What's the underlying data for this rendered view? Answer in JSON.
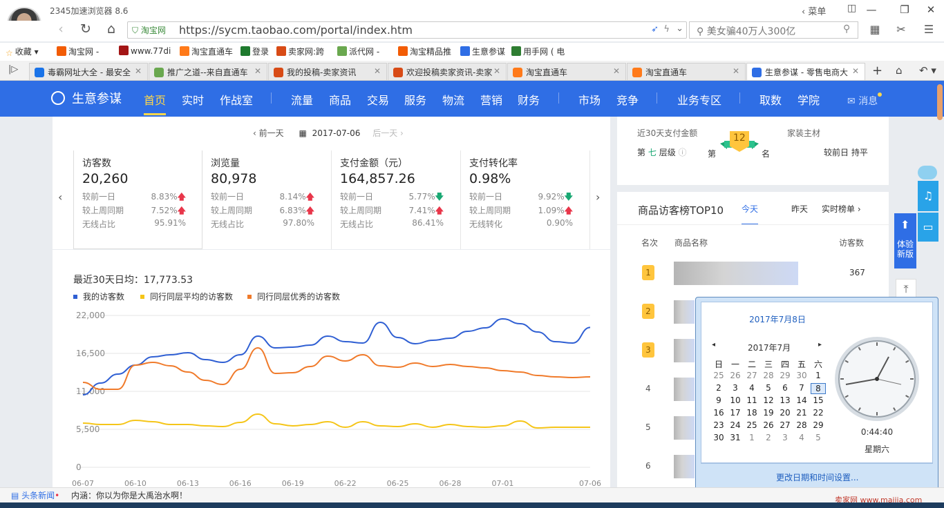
{
  "browser": {
    "title": "2345加速浏览器 8.6",
    "menu_label": "菜单",
    "url": "https://sycm.taobao.com/portal/index.htm",
    "safe_label": "淘宝网",
    "search_placeholder": "美女骗40万人300亿"
  },
  "bookmarks": [
    "收藏",
    "淘宝网 -",
    "www.77di",
    "淘宝直通车",
    "登录",
    "卖家网:跨",
    "派代网 -",
    "淘宝精品推",
    "生意参谋",
    "用手网 ( 电"
  ],
  "tabs": [
    "毒霸网址大全 - 最安全",
    "推广之道--来自直通车",
    "我的投稿-卖家资讯",
    "欢迎投稿卖家资讯-卖家",
    "淘宝直通车",
    "淘宝直通车",
    "生意参谋 - 零售电商大"
  ],
  "app": {
    "brand": "生意参谋",
    "menu": [
      "首页",
      "实时",
      "作战室",
      "流量",
      "商品",
      "交易",
      "服务",
      "物流",
      "营销",
      "财务",
      "市场",
      "竞争",
      "业务专区",
      "取数",
      "学院"
    ],
    "msg": "消息"
  },
  "datebar": {
    "prev": "前一天",
    "date": "2017-07-06",
    "next": "后一天"
  },
  "metrics": [
    {
      "title": "访客数",
      "value": "20,260",
      "r1l": "较前一日",
      "r1v": "8.83%",
      "r1d": "up",
      "r2l": "较上周同期",
      "r2v": "7.52%",
      "r2d": "up",
      "r3l": "无线占比",
      "r3v": "95.91%"
    },
    {
      "title": "浏览量",
      "value": "80,978",
      "r1l": "较前一日",
      "r1v": "8.14%",
      "r1d": "up",
      "r2l": "较上周同期",
      "r2v": "6.83%",
      "r2d": "up",
      "r3l": "无线占比",
      "r3v": "97.80%"
    },
    {
      "title": "支付金额（元）",
      "value": "164,857.26",
      "r1l": "较前一日",
      "r1v": "5.77%",
      "r1d": "dn",
      "r2l": "较上周同期",
      "r2v": "7.41%",
      "r2d": "up",
      "r3l": "无线占比",
      "r3v": "86.41%"
    },
    {
      "title": "支付转化率",
      "value": "0.98%",
      "r1l": "较前一日",
      "r1v": "9.92%",
      "r1d": "dn",
      "r2l": "较上周同期",
      "r2v": "1.09%",
      "r2d": "up",
      "r3l": "无线转化",
      "r3v": "0.90%"
    }
  ],
  "avg_text": "最近30天日均：17,773.53",
  "chart_data": {
    "type": "line",
    "x": [
      "06-07",
      "06-08",
      "06-09",
      "06-10",
      "06-11",
      "06-12",
      "06-13",
      "06-14",
      "06-15",
      "06-16",
      "06-17",
      "06-18",
      "06-19",
      "06-20",
      "06-21",
      "06-22",
      "06-23",
      "06-24",
      "06-25",
      "06-26",
      "06-27",
      "06-28",
      "06-29",
      "06-30",
      "07-01",
      "07-02",
      "07-03",
      "07-04",
      "07-05",
      "07-06"
    ],
    "x_ticks": [
      "06-07",
      "06-10",
      "06-13",
      "06-16",
      "06-19",
      "06-22",
      "06-25",
      "06-28",
      "07-01",
      "07-06"
    ],
    "y_ticks": [
      "22,000",
      "16,500",
      "11,000",
      "5,500",
      "0"
    ],
    "ylim": [
      0,
      22000
    ],
    "series": [
      {
        "name": "我的访客数",
        "color": "#2f5fd3",
        "values": [
          10500,
          12200,
          13500,
          14800,
          16000,
          16300,
          16600,
          15600,
          15200,
          16300,
          19000,
          17300,
          17400,
          17700,
          19000,
          18200,
          18000,
          21000,
          18800,
          17900,
          18400,
          18700,
          19700,
          20200,
          21500,
          20800,
          19600,
          18200,
          18000,
          20260
        ]
      },
      {
        "name": "同行同层平均的访客数",
        "color": "#f5c518",
        "values": [
          6400,
          6200,
          6200,
          6800,
          6600,
          6200,
          6200,
          6000,
          5900,
          6500,
          7700,
          6300,
          6000,
          6200,
          6600,
          5800,
          6600,
          6000,
          5900,
          6300,
          5800,
          6200,
          5900,
          5800,
          6000,
          6700,
          5700,
          5800,
          5800,
          5800
        ]
      },
      {
        "name": "同行同层优秀的访客数",
        "color": "#f07a2a",
        "values": [
          12300,
          11300,
          11300,
          14800,
          15200,
          14700,
          13800,
          12600,
          12000,
          14200,
          17300,
          13600,
          13700,
          14600,
          16100,
          15400,
          16300,
          14700,
          14500,
          15100,
          14600,
          14900,
          14600,
          14400,
          14000,
          13800,
          13300,
          13100,
          13000,
          13100
        ]
      }
    ]
  },
  "rank": {
    "label1": "近30天支付金额",
    "label2": "家装主材",
    "layer_prefix": "第",
    "layer_num": "七",
    "layer_suffix": "层级",
    "rank_no": "12",
    "rank_pre": "第",
    "rank_suf": "名",
    "compare": "较前日 持平"
  },
  "top10": {
    "title": "商品访客榜TOP10",
    "tab_today": "今天",
    "tab_yesterday": "昨天",
    "tab_live": "实时榜单",
    "col_rank": "名次",
    "col_name": "商品名称",
    "col_visits": "访客数",
    "rows": [
      {
        "rank": "1",
        "visits": "367"
      },
      {
        "rank": "2",
        "visits": ""
      },
      {
        "rank": "3",
        "visits": ""
      },
      {
        "rank": "4",
        "visits": ""
      },
      {
        "rank": "5",
        "visits": ""
      },
      {
        "rank": "6",
        "visits": ""
      }
    ]
  },
  "side": {
    "exp": "体验新版"
  },
  "calendar": {
    "header": "2017年7月8日",
    "month": "2017年7月",
    "weekdays": [
      "日",
      "一",
      "二",
      "三",
      "四",
      "五",
      "六"
    ],
    "days": [
      [
        "25",
        "26",
        "27",
        "28",
        "29",
        "30",
        "1"
      ],
      [
        "2",
        "3",
        "4",
        "5",
        "6",
        "7",
        "8"
      ],
      [
        "9",
        "10",
        "11",
        "12",
        "13",
        "14",
        "15"
      ],
      [
        "16",
        "17",
        "18",
        "19",
        "20",
        "21",
        "22"
      ],
      [
        "23",
        "24",
        "25",
        "26",
        "27",
        "28",
        "29"
      ],
      [
        "30",
        "31",
        "1",
        "2",
        "3",
        "4",
        "5"
      ]
    ],
    "time": "0:44:40",
    "weekday": "星期六",
    "change_link": "更改日期和时间设置..."
  },
  "status": {
    "news": "头条新闻",
    "ticker": "内涵：你以为你是大禹治水啊！"
  },
  "watermark": "卖家网 www.maijia.com"
}
